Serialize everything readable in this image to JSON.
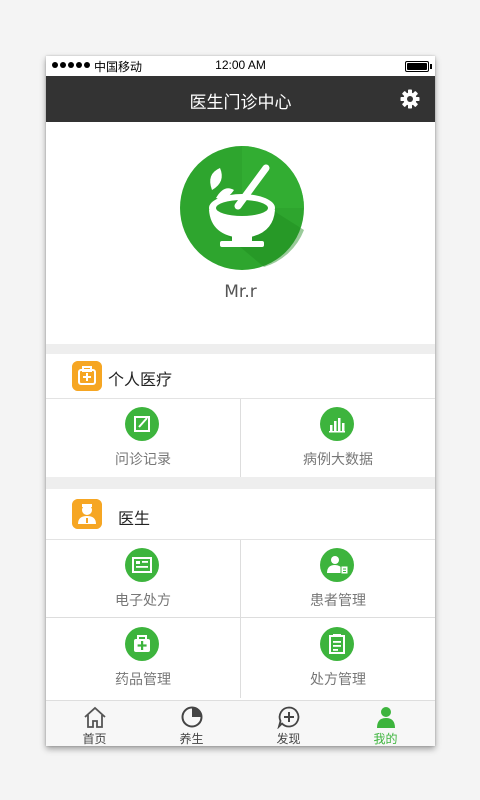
{
  "status_bar": {
    "carrier": "中国移动",
    "time": "12:00 AM"
  },
  "header": {
    "title": "医生门诊中心"
  },
  "profile": {
    "name": "Mr.r"
  },
  "sections": [
    {
      "title": "个人医疗",
      "icon": "medical-kit-icon",
      "items": [
        {
          "label": "问诊记录",
          "icon": "edit-record-icon"
        },
        {
          "label": "病例大数据",
          "icon": "bar-chart-icon"
        }
      ]
    },
    {
      "title": "医生",
      "icon": "doctor-icon",
      "items": [
        {
          "label": "电子处方",
          "icon": "prescription-list-icon"
        },
        {
          "label": "患者管理",
          "icon": "patient-icon"
        },
        {
          "label": "药品管理",
          "icon": "medicine-box-icon"
        },
        {
          "label": "处方管理",
          "icon": "clipboard-icon"
        }
      ]
    }
  ],
  "tabs": [
    {
      "label": "首页",
      "icon": "home-icon"
    },
    {
      "label": "养生",
      "icon": "circle-progress-icon"
    },
    {
      "label": "发现",
      "icon": "discover-icon"
    },
    {
      "label": "我的",
      "icon": "user-icon",
      "active": true
    }
  ],
  "colors": {
    "accent": "#3db43d",
    "navbar": "#333333",
    "section_icon": "#f6a623"
  }
}
